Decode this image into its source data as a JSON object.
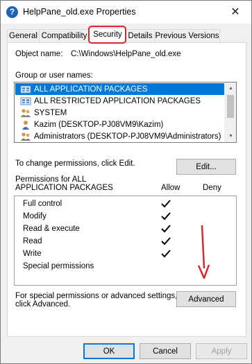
{
  "window": {
    "title": "HelpPane_old.exe Properties",
    "close_symbol": "✕"
  },
  "tabs": [
    {
      "label": "General",
      "active": false
    },
    {
      "label": "Compatibility",
      "active": false
    },
    {
      "label": "Security",
      "active": true
    },
    {
      "label": "Details",
      "active": false
    },
    {
      "label": "Previous Versions",
      "active": false
    }
  ],
  "object": {
    "label": "Object name:",
    "value": "C:\\Windows\\HelpPane_old.exe"
  },
  "groups": {
    "label": "Group or user names:",
    "items": [
      {
        "name": "ALL APPLICATION PACKAGES",
        "icon": "app-packages-icon",
        "selected": true
      },
      {
        "name": "ALL RESTRICTED APPLICATION PACKAGES",
        "icon": "app-packages-icon",
        "selected": false
      },
      {
        "name": "SYSTEM",
        "icon": "users-icon",
        "selected": false
      },
      {
        "name": "Kazim (DESKTOP-PJ08VM9\\Kazim)",
        "icon": "user-icon",
        "selected": false
      },
      {
        "name": "Administrators (DESKTOP-PJ08VM9\\Administrators)",
        "icon": "users-icon",
        "selected": false
      }
    ]
  },
  "change": {
    "text": "To change permissions, click Edit.",
    "button": "Edit..."
  },
  "permissions": {
    "title_line1": "Permissions for ALL",
    "title_line2": "APPLICATION PACKAGES",
    "allow_header": "Allow",
    "deny_header": "Deny",
    "rows": [
      {
        "name": "Full control",
        "allow": true
      },
      {
        "name": "Modify",
        "allow": true
      },
      {
        "name": "Read & execute",
        "allow": true
      },
      {
        "name": "Read",
        "allow": true
      },
      {
        "name": "Write",
        "allow": true
      },
      {
        "name": "Special permissions",
        "allow": false
      }
    ]
  },
  "advanced": {
    "text_line1": "For special permissions or advanced settings,",
    "text_line2": "click Advanced.",
    "button": "Advanced"
  },
  "footer": {
    "ok": "OK",
    "cancel": "Cancel",
    "apply": "Apply"
  },
  "colors": {
    "selection": "#0078d7",
    "annotation": "#d8262f",
    "title_icon": "#1e63b8"
  }
}
